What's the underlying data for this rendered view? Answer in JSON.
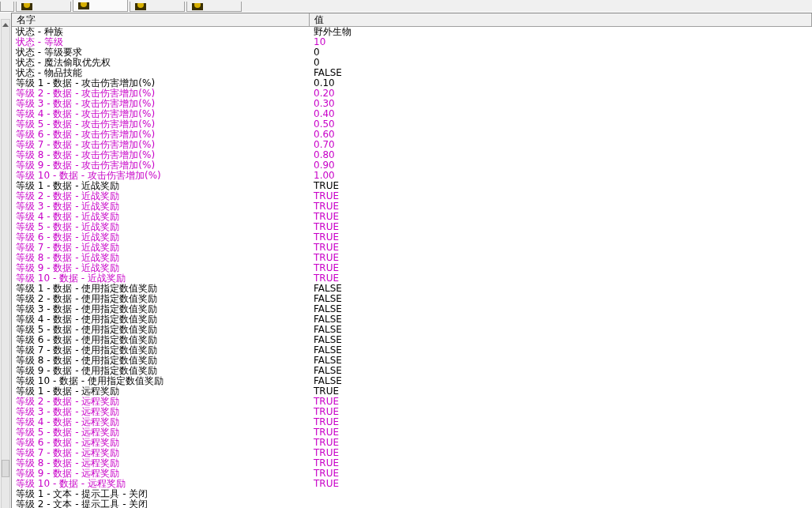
{
  "tabs": [
    {
      "selected": false
    },
    {
      "selected": false
    },
    {
      "selected": true
    },
    {
      "selected": false
    },
    {
      "selected": false
    }
  ],
  "table": {
    "columns": [
      "名字",
      "值"
    ],
    "rows": [
      {
        "name": "状态 - 种族",
        "value": "野外生物",
        "modified": false
      },
      {
        "name": "状态 - 等级",
        "value": "10",
        "modified": true
      },
      {
        "name": "状态 - 等级要求",
        "value": "0",
        "modified": false
      },
      {
        "name": "状态 - 魔法偷取优先权",
        "value": "0",
        "modified": false
      },
      {
        "name": "状态 - 物品技能",
        "value": "FALSE",
        "modified": false
      },
      {
        "name": "等级 1 - 数据 - 攻击伤害增加(%)",
        "value": "0.10",
        "modified": false
      },
      {
        "name": "等级 2 - 数据 - 攻击伤害增加(%)",
        "value": "0.20",
        "modified": true
      },
      {
        "name": "等级 3 - 数据 - 攻击伤害增加(%)",
        "value": "0.30",
        "modified": true
      },
      {
        "name": "等级 4 - 数据 - 攻击伤害增加(%)",
        "value": "0.40",
        "modified": true
      },
      {
        "name": "等级 5 - 数据 - 攻击伤害增加(%)",
        "value": "0.50",
        "modified": true
      },
      {
        "name": "等级 6 - 数据 - 攻击伤害增加(%)",
        "value": "0.60",
        "modified": true
      },
      {
        "name": "等级 7 - 数据 - 攻击伤害增加(%)",
        "value": "0.70",
        "modified": true
      },
      {
        "name": "等级 8 - 数据 - 攻击伤害增加(%)",
        "value": "0.80",
        "modified": true
      },
      {
        "name": "等级 9 - 数据 - 攻击伤害增加(%)",
        "value": "0.90",
        "modified": true
      },
      {
        "name": "等级 10 - 数据 - 攻击伤害增加(%)",
        "value": "1.00",
        "modified": true
      },
      {
        "name": "等级 1 - 数据 - 近战奖励",
        "value": "TRUE",
        "modified": false
      },
      {
        "name": "等级 2 - 数据 - 近战奖励",
        "value": "TRUE",
        "modified": true
      },
      {
        "name": "等级 3 - 数据 - 近战奖励",
        "value": "TRUE",
        "modified": true
      },
      {
        "name": "等级 4 - 数据 - 近战奖励",
        "value": "TRUE",
        "modified": true
      },
      {
        "name": "等级 5 - 数据 - 近战奖励",
        "value": "TRUE",
        "modified": true
      },
      {
        "name": "等级 6 - 数据 - 近战奖励",
        "value": "TRUE",
        "modified": true
      },
      {
        "name": "等级 7 - 数据 - 近战奖励",
        "value": "TRUE",
        "modified": true
      },
      {
        "name": "等级 8 - 数据 - 近战奖励",
        "value": "TRUE",
        "modified": true
      },
      {
        "name": "等级 9 - 数据 - 近战奖励",
        "value": "TRUE",
        "modified": true
      },
      {
        "name": "等级 10 - 数据 - 近战奖励",
        "value": "TRUE",
        "modified": true
      },
      {
        "name": "等级 1 - 数据 - 使用指定数值奖励",
        "value": "FALSE",
        "modified": false
      },
      {
        "name": "等级 2 - 数据 - 使用指定数值奖励",
        "value": "FALSE",
        "modified": false
      },
      {
        "name": "等级 3 - 数据 - 使用指定数值奖励",
        "value": "FALSE",
        "modified": false
      },
      {
        "name": "等级 4 - 数据 - 使用指定数值奖励",
        "value": "FALSE",
        "modified": false
      },
      {
        "name": "等级 5 - 数据 - 使用指定数值奖励",
        "value": "FALSE",
        "modified": false
      },
      {
        "name": "等级 6 - 数据 - 使用指定数值奖励",
        "value": "FALSE",
        "modified": false
      },
      {
        "name": "等级 7 - 数据 - 使用指定数值奖励",
        "value": "FALSE",
        "modified": false
      },
      {
        "name": "等级 8 - 数据 - 使用指定数值奖励",
        "value": "FALSE",
        "modified": false
      },
      {
        "name": "等级 9 - 数据 - 使用指定数值奖励",
        "value": "FALSE",
        "modified": false
      },
      {
        "name": "等级 10 - 数据 - 使用指定数值奖励",
        "value": "FALSE",
        "modified": false
      },
      {
        "name": "等级 1 - 数据 - 远程奖励",
        "value": "TRUE",
        "modified": false
      },
      {
        "name": "等级 2 - 数据 - 远程奖励",
        "value": "TRUE",
        "modified": true
      },
      {
        "name": "等级 3 - 数据 - 远程奖励",
        "value": "TRUE",
        "modified": true
      },
      {
        "name": "等级 4 - 数据 - 远程奖励",
        "value": "TRUE",
        "modified": true
      },
      {
        "name": "等级 5 - 数据 - 远程奖励",
        "value": "TRUE",
        "modified": true
      },
      {
        "name": "等级 6 - 数据 - 远程奖励",
        "value": "TRUE",
        "modified": true
      },
      {
        "name": "等级 7 - 数据 - 远程奖励",
        "value": "TRUE",
        "modified": true
      },
      {
        "name": "等级 8 - 数据 - 远程奖励",
        "value": "TRUE",
        "modified": true
      },
      {
        "name": "等级 9 - 数据 - 远程奖励",
        "value": "TRUE",
        "modified": true
      },
      {
        "name": "等级 10 - 数据 - 远程奖励",
        "value": "TRUE",
        "modified": true
      },
      {
        "name": "等级 1 - 文本 - 提示工具 - 关闭",
        "modified": false
      },
      {
        "name": "等级 2 - 文本 - 提示工具 - 关闭",
        "modified": false
      }
    ]
  }
}
